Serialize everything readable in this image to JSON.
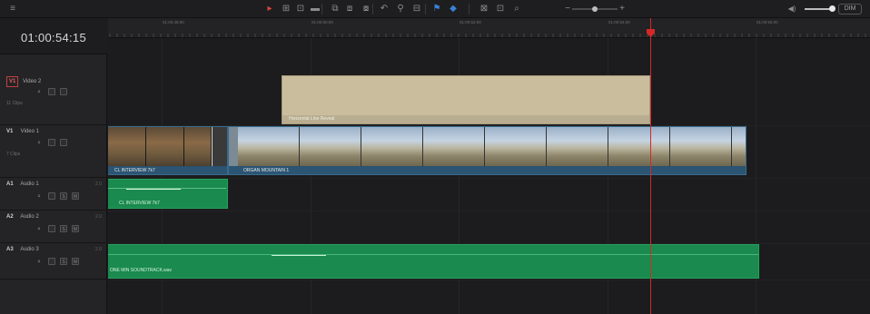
{
  "toolbar": {
    "menu_icon": "≡",
    "tools": [
      {
        "name": "selection-tool-icon",
        "glyph": "▸",
        "color": "#e0483a"
      },
      {
        "name": "trim-tool-icon",
        "glyph": "⊞"
      },
      {
        "name": "dynamic-trim-icon",
        "glyph": "⊡"
      },
      {
        "name": "blade-tool-icon",
        "glyph": "▬"
      },
      {
        "name": "insert-clip-icon",
        "glyph": "⧉"
      },
      {
        "name": "overwrite-clip-icon",
        "glyph": "⧈"
      },
      {
        "name": "replace-clip-icon",
        "glyph": "⧇"
      },
      {
        "name": "snapping-icon",
        "glyph": "↶"
      },
      {
        "name": "linked-selection-icon",
        "glyph": "⚲"
      },
      {
        "name": "position-lock-icon",
        "glyph": "⊟"
      },
      {
        "name": "flag-icon",
        "glyph": "⚑",
        "color": "#3b82d6"
      },
      {
        "name": "marker-icon",
        "glyph": "◆",
        "color": "#3b82d6"
      },
      {
        "name": "full-extent-zoom-icon",
        "glyph": "⊠"
      },
      {
        "name": "detail-zoom-icon",
        "glyph": "⊡"
      },
      {
        "name": "custom-zoom-icon",
        "glyph": "⌕"
      }
    ],
    "zoom_out": "−",
    "zoom_in": "+",
    "volume_icon": "◀)",
    "dim_label": "DIM"
  },
  "timecode": "01:00:54:15",
  "ruler": {
    "labels": [
      "01:00:48:00",
      "01:00:50:00",
      "01:00:52:00",
      "01:00:54:00",
      "01:00:56:00"
    ]
  },
  "tracks": {
    "v2": {
      "id": "V1",
      "name": "Video 2",
      "clips": "11 Clips"
    },
    "v1": {
      "id": "V1",
      "name": "Video 1",
      "clips": "7 Clips"
    },
    "a1": {
      "id": "A1",
      "name": "Audio 1",
      "count": "2.0"
    },
    "a2": {
      "id": "A2",
      "name": "Audio 2",
      "count": "2.0"
    },
    "a3": {
      "id": "A3",
      "name": "Audio 3",
      "count": "2.0"
    }
  },
  "clips": {
    "title_clip": "Horizontal Line Reveal",
    "interview_clip": "CL INTERVIEW 7k7",
    "organ_clip": "ORGAN MOUNTAIN 1",
    "audio1_clip": "CL INTERVIEW 7k7",
    "audio3_clip": "ONE MIN SOUNDTRACK.wav"
  },
  "colors": {
    "playhead": "#d42828",
    "title_clip": "#c9bd9e",
    "video_clip": "#28516f",
    "audio_clip": "#1a8a4e",
    "track_selected": "#c04040"
  }
}
